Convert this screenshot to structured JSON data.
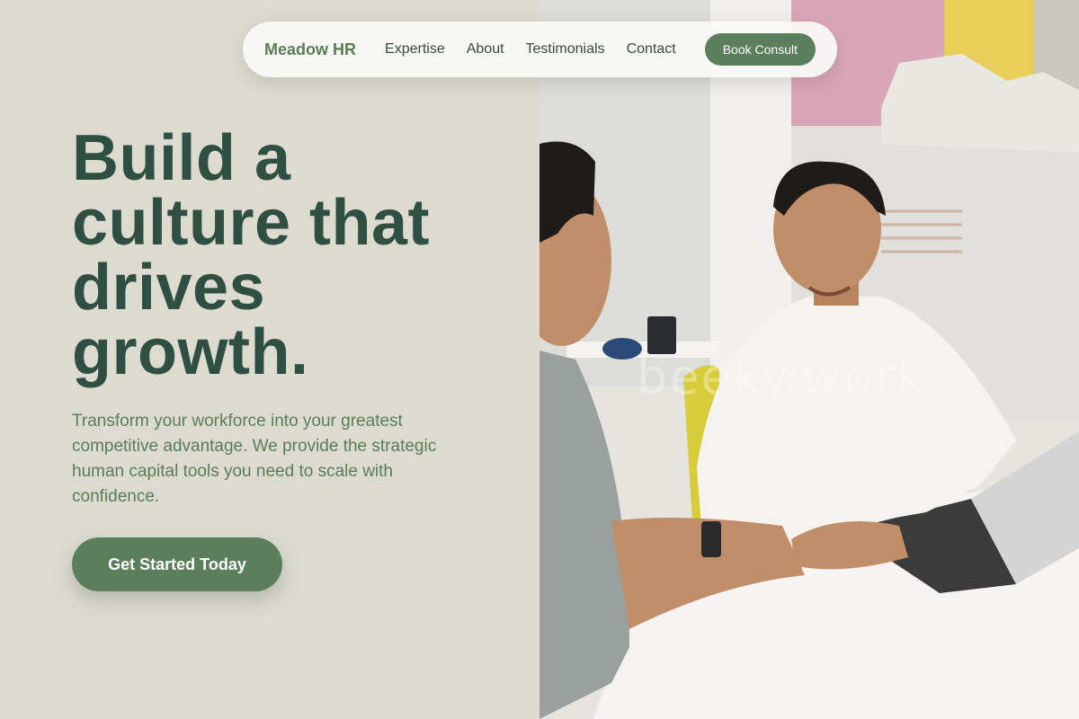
{
  "nav": {
    "brand": "Meadow HR",
    "links": [
      "Expertise",
      "About",
      "Testimonials",
      "Contact"
    ],
    "cta": "Book Consult"
  },
  "hero": {
    "title": "Build a culture that drives growth.",
    "subtitle": "Transform your workforce into your greatest competitive advantage. We provide the strategic human capital tools you need to scale with confidence.",
    "cta": "Get Started Today"
  },
  "photo": {
    "watermark": "beeky.work",
    "description": "two-men-meeting-at-office-desk-photo"
  },
  "colors": {
    "accent": "#5b7f5a",
    "heading": "#2f4f43",
    "background": "#dddbd0"
  }
}
